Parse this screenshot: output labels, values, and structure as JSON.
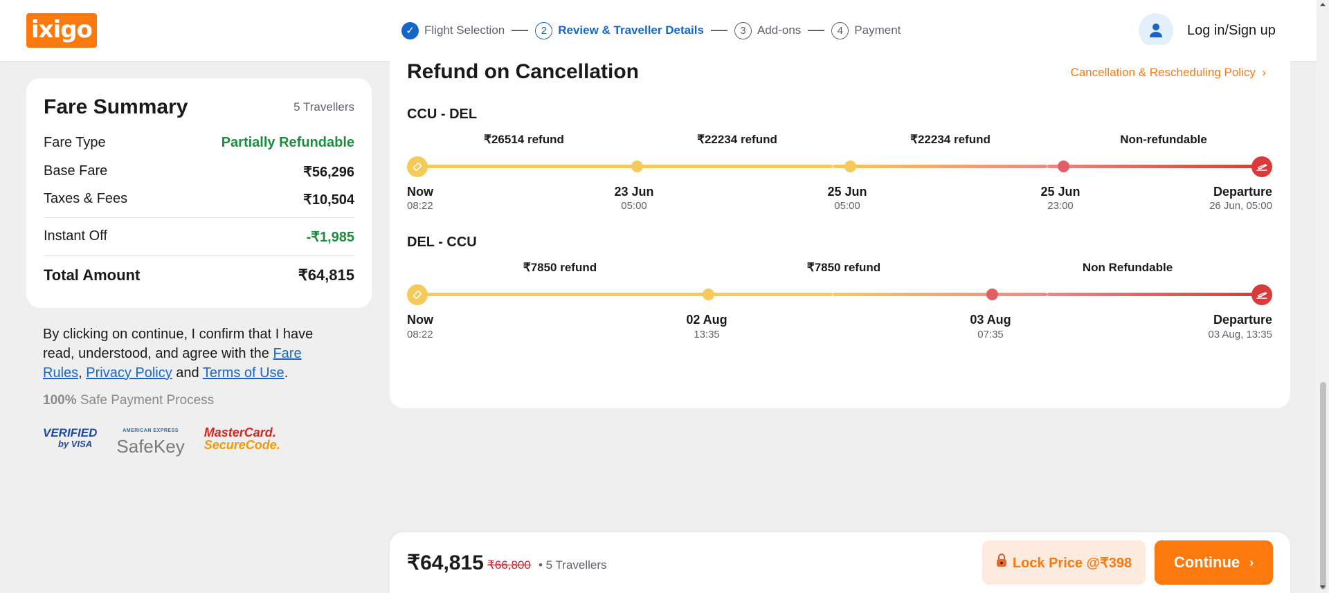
{
  "header": {
    "logo": "ixigo",
    "steps": [
      {
        "num": "✓",
        "label": "Flight Selection",
        "state": "done"
      },
      {
        "num": "2",
        "label": "Review & Traveller Details",
        "state": "active"
      },
      {
        "num": "3",
        "label": "Add-ons",
        "state": "upcoming"
      },
      {
        "num": "4",
        "label": "Payment",
        "state": "upcoming"
      }
    ],
    "login_label": "Log in/Sign up",
    "avatar_icon": "user-icon"
  },
  "fare_summary": {
    "title": "Fare Summary",
    "travellers": "5 Travellers",
    "fare_type_label": "Fare Type",
    "fare_type_value": "Partially Refundable",
    "base_fare_label": "Base Fare",
    "base_fare_value": "₹56,296",
    "taxes_label": "Taxes & Fees",
    "taxes_value": "₹10,504",
    "instant_off_label": "Instant Off",
    "instant_off_value": "-₹1,985",
    "total_label": "Total Amount",
    "total_value": "₹64,815"
  },
  "confirm": {
    "text_1": "By clicking on continue, I confirm that I have read, understood, and agree with the ",
    "fare_rules": "Fare Rules",
    "sep_1": ", ",
    "privacy": "Privacy Policy",
    "sep_2": " and ",
    "terms": "Terms of Use",
    "end": "."
  },
  "safe_payment": {
    "bold": "100%",
    "text": " Safe Payment Process"
  },
  "badges": {
    "visa_line1": "VERIFIED",
    "visa_line2": "by VISA",
    "amex_top": "AMERICAN EXPRESS",
    "amex_main": "SafeKey",
    "mc_line1": "MasterCard.",
    "mc_line2": "SecureCode."
  },
  "refund": {
    "title": "Refund on Cancellation",
    "policy_link": "Cancellation & Rescheduling Policy",
    "routes": [
      {
        "name": "CCU - DEL",
        "segments": [
          "₹26514 refund",
          "₹22234 refund",
          "₹22234 refund",
          "Non-refundable"
        ],
        "ticks": [
          {
            "label": "Now",
            "sub": "08:22"
          },
          {
            "label": "23 Jun",
            "sub": "05:00"
          },
          {
            "label": "25 Jun",
            "sub": "05:00"
          },
          {
            "label": "25 Jun",
            "sub": "23:00"
          },
          {
            "label": "Departure",
            "sub": "26 Jun, 05:00"
          }
        ]
      },
      {
        "name": "DEL - CCU",
        "segments": [
          "₹7850 refund",
          "₹7850 refund",
          "Non Refundable"
        ],
        "ticks": [
          {
            "label": "Now",
            "sub": "08:22"
          },
          {
            "label": "02 Aug",
            "sub": "13:35"
          },
          {
            "label": "03 Aug",
            "sub": "07:35"
          },
          {
            "label": "Departure",
            "sub": "03 Aug, 13:35"
          }
        ]
      }
    ]
  },
  "bottom_bar": {
    "price": "₹64,815",
    "old_price": "₹66,800",
    "travellers": "• 5 Travellers",
    "lock_label": "Lock Price @₹398",
    "continue_label": "Continue"
  },
  "colors": {
    "brand": "#fc790d",
    "link": "#1766c7",
    "green": "#1b8e3e",
    "refund_yellow": "#f6c95b",
    "refund_red": "#d93a3a"
  }
}
